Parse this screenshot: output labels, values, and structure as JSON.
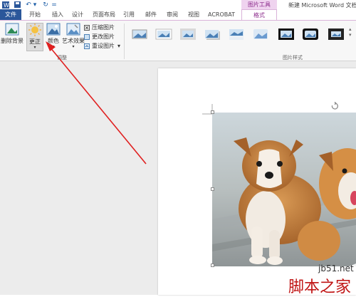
{
  "title_bar": {
    "doc_title": "新建 Microsoft Word 文档",
    "context_group": "图片工具"
  },
  "tabs": [
    "文件",
    "开始",
    "插入",
    "设计",
    "页面布局",
    "引用",
    "邮件",
    "审阅",
    "视图",
    "ACROBAT",
    "格式"
  ],
  "ribbon": {
    "remove_bg": "删除背景",
    "corrections": "更正",
    "color": "颜色",
    "artistic": "艺术效果",
    "compress": "压缩图片",
    "change": "更改图片",
    "reset": "重设图片",
    "adjust_group": "调整",
    "styles_group": "图片样式"
  },
  "watermark": {
    "site": "jb51.net",
    "brand": "脚本之家"
  },
  "colors": {
    "file_tab": "#2b579a",
    "context_tab": "#8b2a8b",
    "arrow": "#e02020"
  }
}
